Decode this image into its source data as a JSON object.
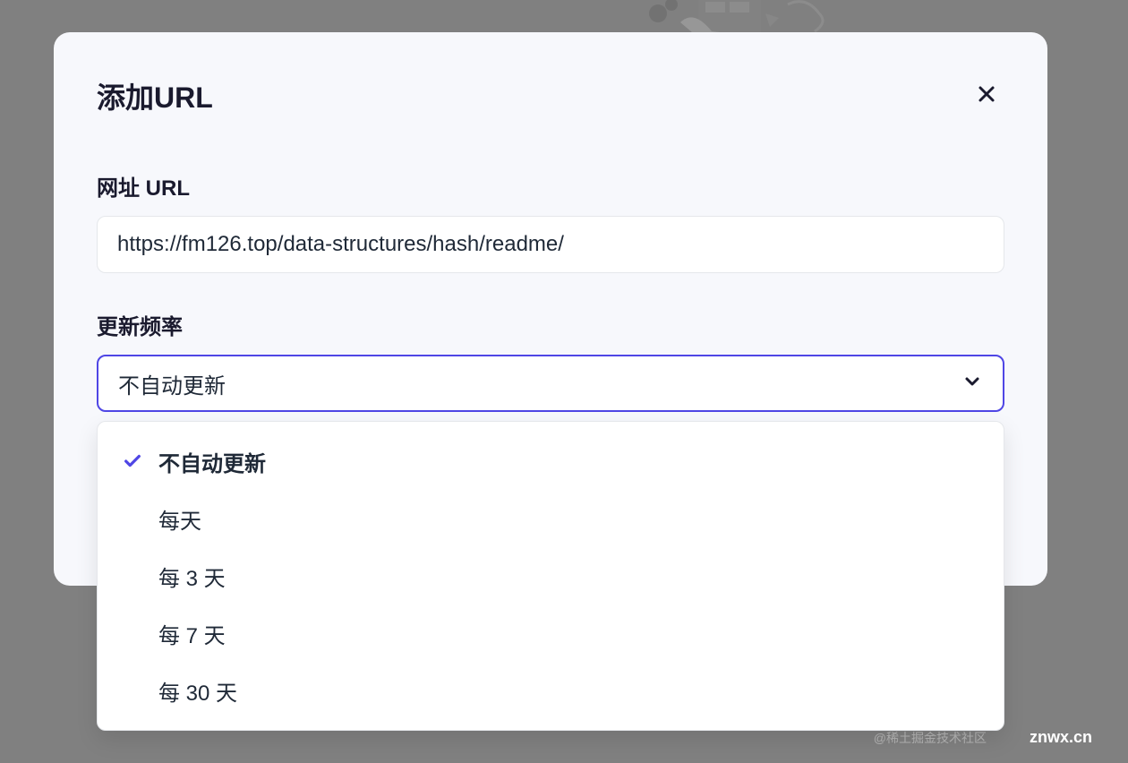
{
  "modal": {
    "title": "添加URL",
    "url_label": "网址 URL",
    "url_value": "https://fm126.top/data-structures/hash/readme/",
    "frequency_label": "更新频率",
    "frequency_selected": "不自动更新"
  },
  "dropdown": {
    "options": [
      {
        "label": "不自动更新",
        "selected": true
      },
      {
        "label": "每天",
        "selected": false
      },
      {
        "label": "每 3 天",
        "selected": false
      },
      {
        "label": "每 7 天",
        "selected": false
      },
      {
        "label": "每 30 天",
        "selected": false
      }
    ]
  },
  "watermark": "znwx.cn",
  "watermark_sub": "@稀土掘金技术社区"
}
